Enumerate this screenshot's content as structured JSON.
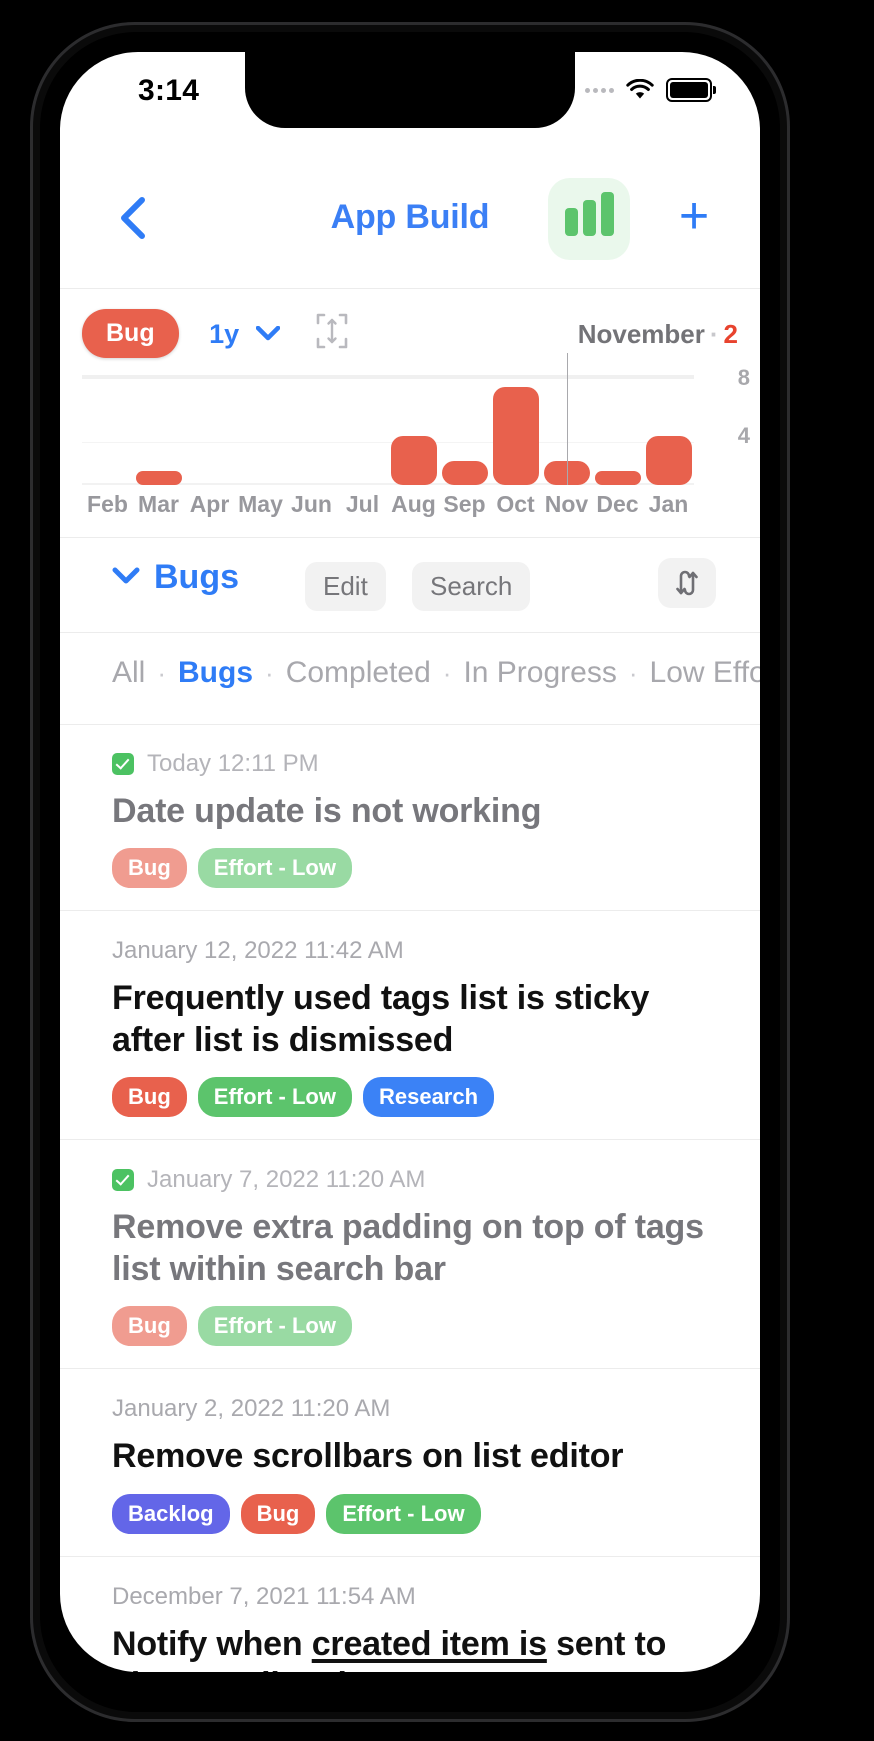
{
  "status_bar": {
    "time": "3:14",
    "wifi_icon": "wifi-icon",
    "battery_icon": "battery-icon",
    "signal_icon": "signal-dots-icon"
  },
  "nav": {
    "back_icon": "chevron-left-icon",
    "title": "App Build",
    "chart_button_icon": "bar-chart-icon",
    "add_button_label": "+",
    "accent": "#3b7ff5",
    "chart_button_bg": "#eaf8ec"
  },
  "chart_toolbar": {
    "filter_pill": "Bug",
    "filter_pill_color": "#e8614d",
    "range": "1y",
    "range_chevron_icon": "chevron-down-icon",
    "expand_icon": "expand-icon",
    "selection_month": "November",
    "selection_separator": "·",
    "selection_count": "2",
    "selection_count_color": "#e8432e"
  },
  "chart_data": {
    "type": "bar",
    "title": "",
    "categories": [
      "Feb",
      "Mar",
      "Apr",
      "May",
      "Jun",
      "Jul",
      "Aug",
      "Sep",
      "Oct",
      "Nov",
      "Dec",
      "Jan"
    ],
    "values": [
      0,
      1,
      0,
      0,
      0,
      0,
      4,
      2,
      8,
      2,
      1,
      4
    ],
    "ylim": [
      0,
      9
    ],
    "yticks": [
      "8",
      "4"
    ],
    "ytick_values": [
      8,
      4
    ],
    "xlabel": "",
    "ylabel": "",
    "grid": true,
    "legend": "none",
    "series_color": "#e8614d",
    "highlight_category": "Nov",
    "highlight_value": 2
  },
  "list_toolbar": {
    "collapse_icon": "chevron-down-icon",
    "title": "Bugs",
    "edit_label": "Edit",
    "search_label": "Search",
    "sort_icon": "sort-icon"
  },
  "filter_tabs": {
    "separator": "·",
    "items": [
      {
        "label": "All",
        "active": false
      },
      {
        "label": "Bugs",
        "active": true
      },
      {
        "label": "Completed",
        "active": false
      },
      {
        "label": "In Progress",
        "active": false
      },
      {
        "label": "Low Effort Items",
        "active": false
      }
    ]
  },
  "tag_colors": {
    "Bug": "#e8614d",
    "Effort - Low": "#5cc46c",
    "Research": "#3b82f6",
    "Backlog": "#6366e8"
  },
  "items": [
    {
      "completed": true,
      "date": "Today 12:11 PM",
      "title": "Date update is not working",
      "tags": [
        "Bug",
        "Effort - Low"
      ]
    },
    {
      "completed": false,
      "date": "January 12, 2022 11:42 AM",
      "title": "Frequently used tags list is sticky after list is dismissed",
      "tags": [
        "Bug",
        "Effort - Low",
        "Research"
      ]
    },
    {
      "completed": true,
      "date": "January 7, 2022 11:20 AM",
      "title": "Remove extra padding on top of tags list within search bar",
      "tags": [
        "Bug",
        "Effort - Low"
      ]
    },
    {
      "completed": false,
      "date": "January 2, 2022 11:20 AM",
      "title": "Remove scrollbars on list editor",
      "tags": [
        "Backlog",
        "Bug",
        "Effort - Low"
      ]
    },
    {
      "completed": false,
      "date": "December 7, 2021 11:54 AM",
      "title_part_1": "Notify when ",
      "title_underlined": "created item is",
      "title_part_2": " sent to",
      "title_line_2": "alternate list view",
      "tags": []
    }
  ]
}
